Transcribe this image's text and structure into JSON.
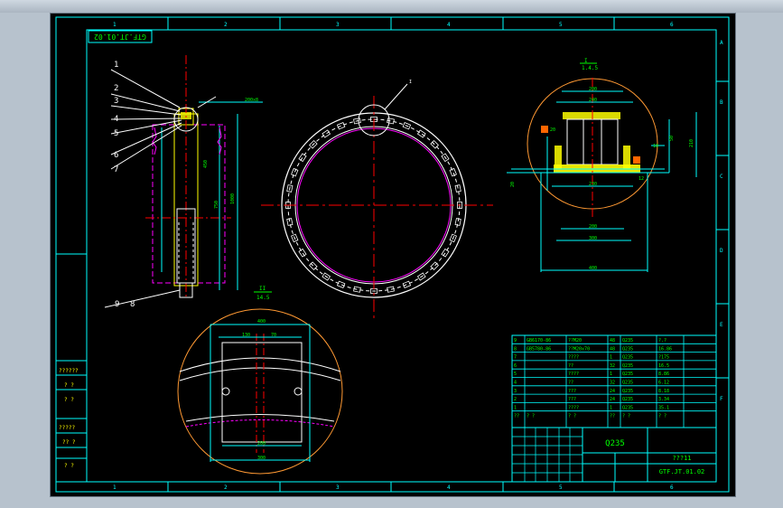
{
  "drawing": {
    "number_rotated": "GTF.JT.01.02",
    "material_box": "Q235",
    "title_code": "GTF.JT.01.02",
    "title_marks": "???11"
  },
  "columns": [
    "1",
    "2",
    "3",
    "4",
    "5",
    "6"
  ],
  "rows": [
    "A",
    "B",
    "C",
    "D",
    "E",
    "F"
  ],
  "callouts": [
    "1",
    "2",
    "3",
    "4",
    "5",
    "6",
    "7",
    "9",
    "8"
  ],
  "detail_views": [
    {
      "label": "I",
      "scale": "1.4.5"
    },
    {
      "label": "II",
      "scale": "14.5"
    }
  ],
  "bom": [
    {
      "no": "9",
      "code": "GB6170-86",
      "name": "??M20",
      "qty": "48",
      "mat": "Q235",
      "wt": "?.?"
    },
    {
      "no": "8",
      "code": "GB5780-86",
      "name": "??M20x70",
      "qty": "48",
      "mat": "Q235",
      "wt": "16.86"
    },
    {
      "no": "7",
      "code": "",
      "name": "????",
      "qty": "1",
      "mat": "Q235",
      "wt": "?175"
    },
    {
      "no": "6",
      "code": "",
      "name": "??",
      "qty": "32",
      "mat": "Q235",
      "wt": "16.5"
    },
    {
      "no": "5",
      "code": "",
      "name": "????",
      "qty": "1",
      "mat": "Q235",
      "wt": "8.86"
    },
    {
      "no": "4",
      "code": "",
      "name": "??",
      "qty": "32",
      "mat": "Q235",
      "wt": "6.12"
    },
    {
      "no": "3",
      "code": "",
      "name": "???",
      "qty": "24",
      "mat": "Q235",
      "wt": "8.18"
    },
    {
      "no": "2",
      "code": "",
      "name": "???",
      "qty": "24",
      "mat": "Q235",
      "wt": "3.34"
    },
    {
      "no": "1",
      "code": "",
      "name": "????",
      "qty": "1",
      "mat": "Q235",
      "wt": "35.1"
    }
  ],
  "bom_header": [
    "??",
    "? ?",
    "? ?",
    "??",
    "? ?",
    "? ?"
  ],
  "left_margin_labels": [
    "??????",
    "? ?",
    "? ?",
    "?????",
    "?? ?",
    "? ?"
  ],
  "colors": {
    "frame": "#00ffff",
    "green": "#00ff00",
    "yellow": "#ffff00",
    "magenta": "#ff00ff",
    "red": "#ff0000",
    "white": "#ffffff",
    "orange": "#ffb040"
  }
}
